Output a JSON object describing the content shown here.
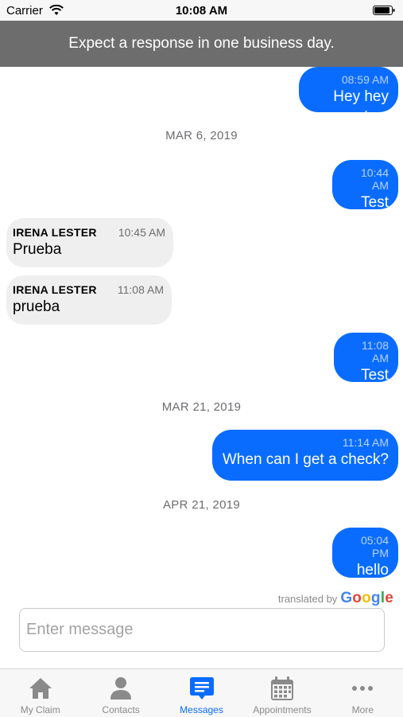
{
  "status_bar": {
    "carrier": "Carrier",
    "time": "10:08 AM"
  },
  "banner": {
    "text": "Expect a response in one business day."
  },
  "dates": [
    "MAR 6, 2019",
    "MAR 21, 2019",
    "APR 21, 2019"
  ],
  "messages": [
    {
      "time": "08:59 AM",
      "text": "Hey hey hey"
    },
    {
      "time": "10:44 AM",
      "text": "Test"
    },
    {
      "sender": "IRENA LESTER",
      "time": "10:45 AM",
      "text": "Prueba"
    },
    {
      "sender": "IRENA LESTER",
      "time": "11:08 AM",
      "text": "prueba"
    },
    {
      "time": "11:08 AM",
      "text": "Test"
    },
    {
      "time": "11:14 AM",
      "text": "When can I get a check?"
    },
    {
      "time": "05:04 PM",
      "text": "hello"
    }
  ],
  "translated": {
    "label": "translated by",
    "brand": "Google"
  },
  "input": {
    "placeholder": "Enter message"
  },
  "tabs": [
    {
      "label": "My Claim",
      "icon": "home-icon"
    },
    {
      "label": "Contacts",
      "icon": "person-icon"
    },
    {
      "label": "Messages",
      "icon": "messages-icon",
      "active": true
    },
    {
      "label": "Appointments",
      "icon": "calendar-icon"
    },
    {
      "label": "More",
      "icon": "more-icon"
    }
  ],
  "colors": {
    "accent": "#0a6cff",
    "banner": "#6d6d6d",
    "incoming_bubble": "#efefef",
    "inactive_icon": "#8a8a8a"
  }
}
